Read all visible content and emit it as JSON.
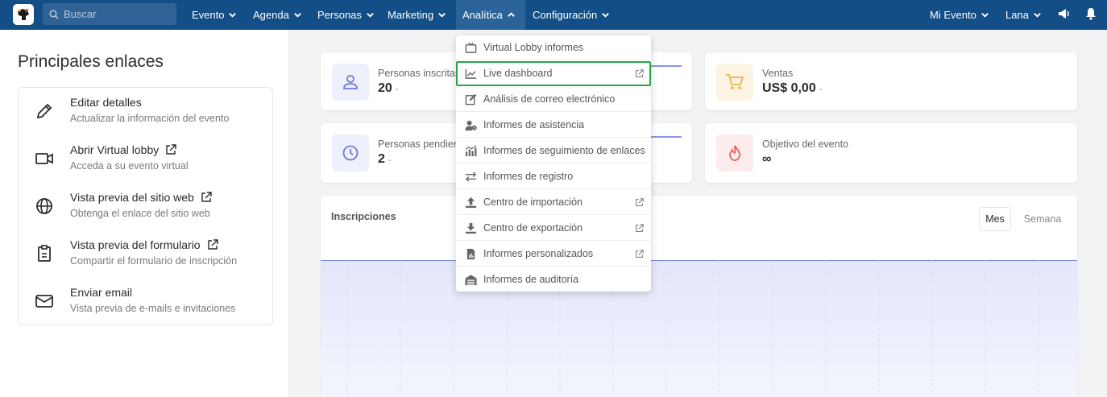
{
  "search": {
    "placeholder": "Buscar"
  },
  "nav": {
    "evento": "Evento",
    "agenda": "Agenda",
    "personas": "Personas",
    "marketing": "Marketing",
    "analitica": "Analítica",
    "configuracion": "Configuración",
    "mi_evento": "Mi Evento",
    "lana": "Lana"
  },
  "left": {
    "title": "Principales enlaces",
    "items": [
      {
        "title": "Editar detalles",
        "sub": "Actualizar la información del evento",
        "icon": "pencil-icon"
      },
      {
        "title": "Abrir Virtual lobby",
        "sub": "Acceda a su evento virtual",
        "icon": "video-camera-icon"
      },
      {
        "title": "Vista previa del sitio web",
        "sub": "Obtenga el enlace del sitio web",
        "icon": "globe-icon"
      },
      {
        "title": "Vista previa del formulario",
        "sub": "Compartir el formulario de inscripción",
        "icon": "clipboard-icon"
      },
      {
        "title": "Enviar email",
        "sub": "Vista previa de e-mails e invitaciones",
        "icon": "envelope-icon"
      }
    ]
  },
  "stats": {
    "inscritas": {
      "label": "Personas inscritas",
      "value": "20",
      "suffix": "-"
    },
    "pendientes": {
      "label": "Personas pendientes",
      "value": "2",
      "suffix": "-"
    },
    "ventas": {
      "label": "Ventas",
      "value": "US$ 0,00",
      "suffix": "-"
    },
    "objetivo": {
      "label": "Objetivo del evento",
      "value": "∞"
    }
  },
  "chart": {
    "title": "Inscripciones",
    "mes": "Mes",
    "semana": "Semana"
  },
  "dropdown": {
    "items": [
      {
        "label": "Virtual Lobby informes",
        "icon": "tv-icon"
      },
      {
        "label": "Live dashboard",
        "icon": "line-chart-icon"
      },
      {
        "label": "Análisis de correo electrónico",
        "icon": "edit-icon"
      },
      {
        "label": "Informes de asistencia",
        "icon": "user-clock-icon"
      },
      {
        "label": "Informes de seguimiento de enlaces",
        "icon": "bar-chart-icon"
      },
      {
        "label": "Informes de registro",
        "icon": "exchange-icon"
      },
      {
        "label": "Centro de importación",
        "icon": "upload-icon"
      },
      {
        "label": "Centro de exportación",
        "icon": "download-icon"
      },
      {
        "label": "Informes personalizados",
        "icon": "file-icon"
      },
      {
        "label": "Informes de auditoría",
        "icon": "warehouse-icon"
      }
    ]
  },
  "colors": {
    "topbar": "#134f86",
    "highlight": "#26a64a",
    "accent": "#8a94e6"
  }
}
